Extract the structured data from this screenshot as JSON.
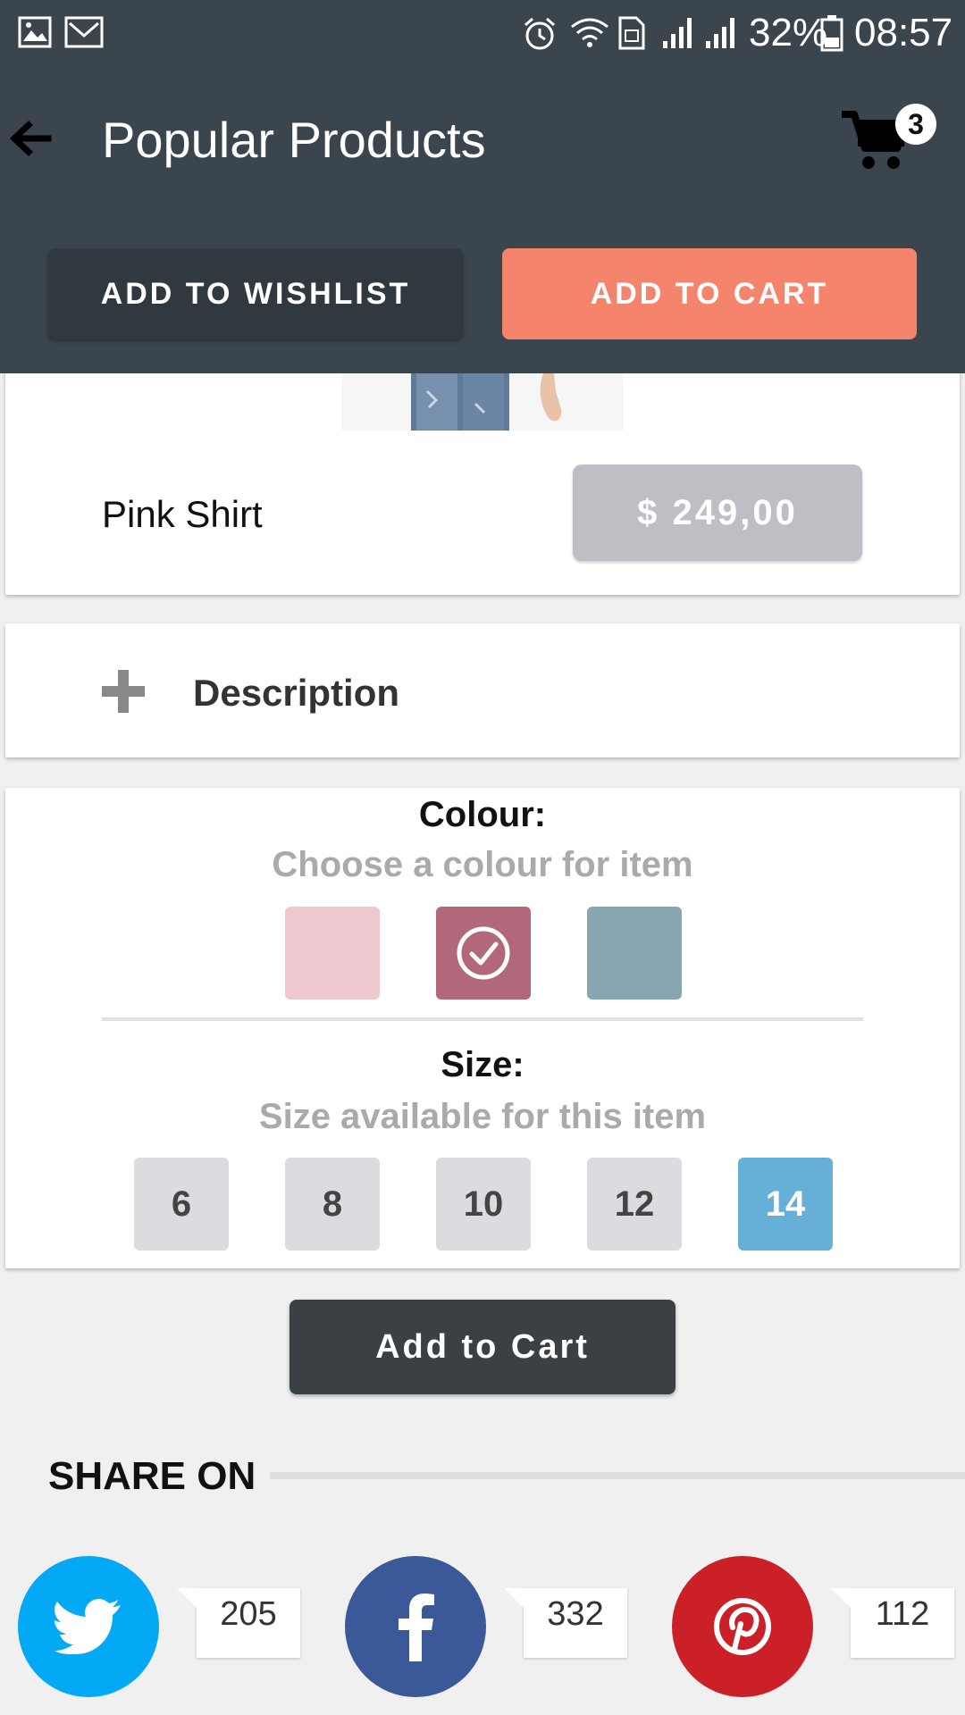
{
  "status_bar": {
    "battery": "32%",
    "time": "08:57"
  },
  "header": {
    "title": "Popular Products",
    "cart_count": "3",
    "wishlist_label": "ADD TO WISHLIST",
    "add_to_cart_label": "ADD TO CART"
  },
  "product": {
    "name": "Pink Shirt",
    "price": "$ 249,00"
  },
  "description": {
    "label": "Description"
  },
  "colour": {
    "title": "Colour:",
    "subtitle": "Choose a colour for item",
    "swatches": [
      "#f0c8d0",
      "#b0687a",
      "#88a6b2"
    ],
    "selected_index": 1
  },
  "size": {
    "title": "Size:",
    "subtitle": "Size available for this item",
    "options": [
      "6",
      "8",
      "10",
      "12",
      "14"
    ],
    "selected": "14"
  },
  "main_button": {
    "label": "Add to Cart"
  },
  "share": {
    "title": "SHARE ON",
    "networks": [
      {
        "name": "twitter",
        "icon": "twitter-icon",
        "color": "#03a9f4",
        "count": "205"
      },
      {
        "name": "facebook",
        "icon": "facebook-icon",
        "color": "#3b5998",
        "count": "332"
      },
      {
        "name": "pinterest",
        "icon": "pinterest-icon",
        "color": "#cb2027",
        "count": "112"
      }
    ]
  }
}
